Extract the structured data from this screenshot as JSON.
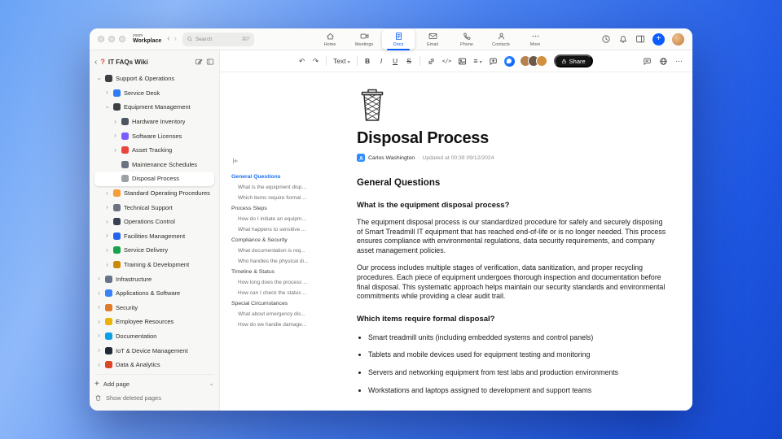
{
  "accent": {
    "zoom_blue": "#0b5cff",
    "outline_active_blue": "#1a6ef5",
    "share_button_black": "#151515"
  },
  "titlebar": {
    "brand": {
      "top": "zoom",
      "bottom": "Workplace"
    },
    "search": {
      "placeholder": "Search",
      "shortcut": "⌘F"
    },
    "tabs": [
      {
        "label": "Home",
        "active": false
      },
      {
        "label": "Meetings",
        "active": false
      },
      {
        "label": "Docs",
        "active": true
      },
      {
        "label": "Email",
        "active": false
      },
      {
        "label": "Phone",
        "active": false
      },
      {
        "label": "Contacts",
        "active": false
      },
      {
        "label": "More",
        "active": false
      }
    ]
  },
  "sidebar": {
    "title_icon": "?",
    "title": "IT FAQs Wiki",
    "items": [
      {
        "label": "Support & Operations",
        "icon": "phone-icon",
        "color": "#3d4043",
        "level": 0,
        "chevron": "down"
      },
      {
        "label": "Service Desk",
        "icon": "headset-icon",
        "color": "#2e7cf6",
        "level": 1,
        "chevron": "right"
      },
      {
        "label": "Equipment Management",
        "icon": "monitor-icon",
        "color": "#3d4043",
        "level": 1,
        "chevron": "down"
      },
      {
        "label": "Hardware Inventory",
        "icon": "wrench-icon",
        "color": "#4b5563",
        "level": 2,
        "chevron": "right"
      },
      {
        "label": "Software Licenses",
        "icon": "disc-icon",
        "color": "#7c5cff",
        "level": 2,
        "chevron": "right"
      },
      {
        "label": "Asset Tracking",
        "icon": "pin-icon",
        "color": "#e8453c",
        "level": 2,
        "chevron": "right"
      },
      {
        "label": "Maintenance Schedules",
        "icon": "tools-icon",
        "color": "#6b7280",
        "level": 2,
        "chevron": "none"
      },
      {
        "label": "Disposal Process",
        "icon": "trash-icon",
        "color": "#9aa0a6",
        "level": 2,
        "chevron": "none",
        "selected": true
      },
      {
        "label": "Standard Operating Procedures",
        "icon": "book-icon",
        "color": "#f29d38",
        "level": 1,
        "chevron": "right"
      },
      {
        "label": "Technical Support",
        "icon": "support-icon",
        "color": "#6b7280",
        "level": 1,
        "chevron": "right"
      },
      {
        "label": "Operations Control",
        "icon": "sliders-icon",
        "color": "#374151",
        "level": 1,
        "chevron": "right"
      },
      {
        "label": "Facilities Management",
        "icon": "building-icon",
        "color": "#2563eb",
        "level": 1,
        "chevron": "right"
      },
      {
        "label": "Service Delivery",
        "icon": "truck-icon",
        "color": "#16a34a",
        "level": 1,
        "chevron": "right"
      },
      {
        "label": "Training & Development",
        "icon": "graduation-icon",
        "color": "#ca8a04",
        "level": 1,
        "chevron": "right"
      },
      {
        "label": "Infrastructure",
        "icon": "server-icon",
        "color": "#64748b",
        "level": 0,
        "chevron": "right"
      },
      {
        "label": "Applications & Software",
        "icon": "apps-icon",
        "color": "#3b82f6",
        "level": 0,
        "chevron": "right"
      },
      {
        "label": "Security",
        "icon": "shield-icon",
        "color": "#e07b28",
        "level": 0,
        "chevron": "right"
      },
      {
        "label": "Employee Resources",
        "icon": "people-icon",
        "color": "#eab308",
        "level": 0,
        "chevron": "right"
      },
      {
        "label": "Documentation",
        "icon": "books-icon",
        "color": "#0e9fe5",
        "level": 0,
        "chevron": "right"
      },
      {
        "label": "IoT & Device Management",
        "icon": "chip-icon",
        "color": "#1f2937",
        "level": 0,
        "chevron": "right"
      },
      {
        "label": "Data & Analytics",
        "icon": "chart-icon",
        "color": "#dc4626",
        "level": 0,
        "chevron": "right"
      }
    ],
    "footer": {
      "add_page": "Add page",
      "show_deleted": "Show deleted pages"
    }
  },
  "toolbar": {
    "undo": "↶",
    "redo": "↷",
    "text_style": "Text",
    "bold": "B",
    "italic": "I",
    "underline": "U",
    "strikethrough": "S",
    "code": "</>",
    "list": "≡",
    "share": "Share",
    "more": "⋯",
    "collaborators": [
      {
        "color": "#b5824e"
      },
      {
        "color": "#6b5a4a"
      },
      {
        "color": "#d1913f"
      }
    ]
  },
  "outline": {
    "items": [
      {
        "label": "General Questions",
        "level": 0,
        "active": true
      },
      {
        "label": "What is the equipment disp...",
        "level": 1
      },
      {
        "label": "Which items require formal ...",
        "level": 1
      },
      {
        "label": "Process Steps",
        "level": 0
      },
      {
        "label": "How do I initiate an equipm...",
        "level": 1
      },
      {
        "label": "What happens to sensitive ...",
        "level": 1
      },
      {
        "label": "Compliance & Security",
        "level": 0
      },
      {
        "label": "What documentation is req...",
        "level": 1
      },
      {
        "label": "Who handles the physical di...",
        "level": 1
      },
      {
        "label": "Timeline & Status",
        "level": 0
      },
      {
        "label": "How long does the process ...",
        "level": 1
      },
      {
        "label": "How can I check the status ...",
        "level": 1
      },
      {
        "label": "Special Circumstances",
        "level": 0
      },
      {
        "label": "What about emergency dis...",
        "level": 1
      },
      {
        "label": "How do we handle damage...",
        "level": 1
      }
    ]
  },
  "doc": {
    "title": "Disposal Process",
    "author": "Carlos Washington",
    "updated": "Updated at 00:39 09/12/2024",
    "section_heading": "General Questions",
    "qa": [
      {
        "question": "What is the equipment disposal process?",
        "paragraphs": [
          "The equipment disposal process is our standardized procedure for safely and securely disposing of Smart Treadmill IT equipment that has reached end-of-life or is no longer needed. This process ensures compliance with environmental regulations, data security requirements, and company asset management policies.",
          "Our process includes multiple stages of verification, data sanitization, and proper recycling procedures. Each piece of equipment undergoes thorough inspection and documentation before final disposal. This systematic approach helps maintain our security standards and environmental commitments while providing a clear audit trail."
        ]
      },
      {
        "question": "Which items require formal disposal?",
        "bullets": [
          "Smart treadmill units (including embedded systems and control panels)",
          "Tablets and mobile devices used for equipment testing and monitoring",
          "Servers and networking equipment from test labs and production environments",
          "Workstations and laptops assigned to development and support teams"
        ]
      }
    ]
  }
}
